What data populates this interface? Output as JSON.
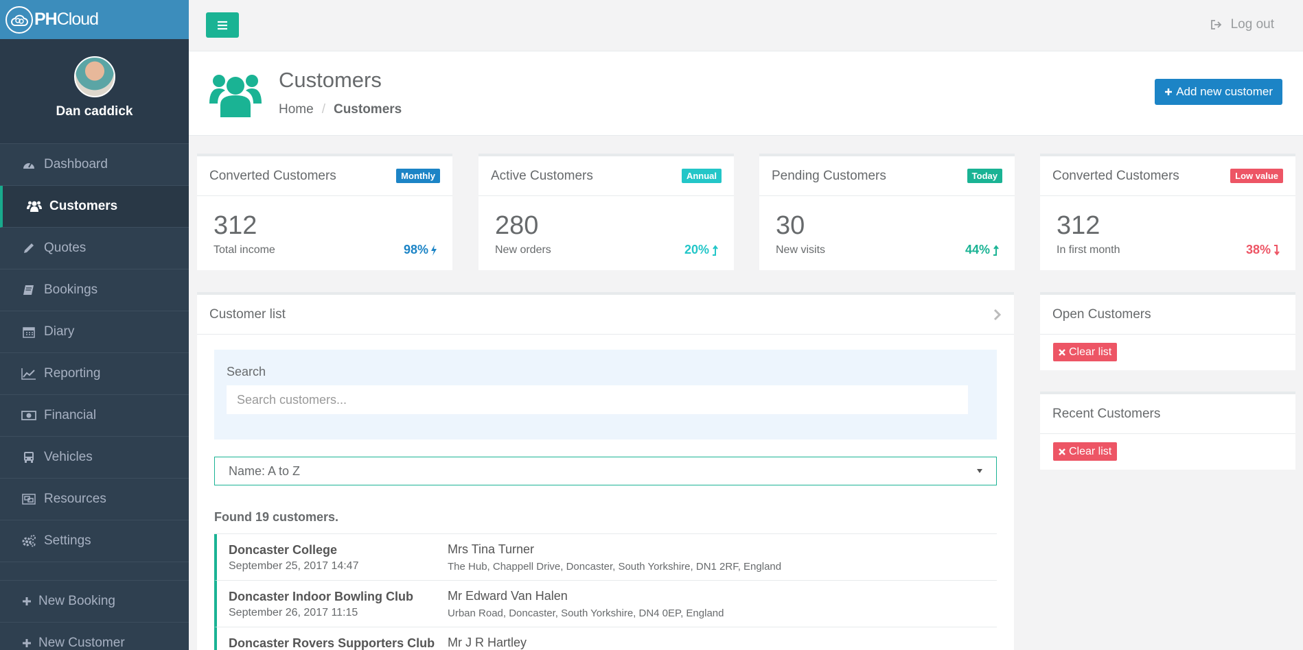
{
  "brand": {
    "name": "PHCloud",
    "name_bold": "PH",
    "name_rest": "Cloud"
  },
  "user": {
    "name": "Dan caddick"
  },
  "sidebar": {
    "items": [
      {
        "label": "Dashboard",
        "icon": "dashboard-icon"
      },
      {
        "label": "Customers",
        "icon": "users-icon",
        "active": true
      },
      {
        "label": "Quotes",
        "icon": "pencil-icon"
      },
      {
        "label": "Bookings",
        "icon": "book-icon"
      },
      {
        "label": "Diary",
        "icon": "calendar-icon"
      },
      {
        "label": "Reporting",
        "icon": "line-chart-icon"
      },
      {
        "label": "Financial",
        "icon": "money-icon"
      },
      {
        "label": "Vehicles",
        "icon": "bus-icon"
      },
      {
        "label": "Resources",
        "icon": "object-group-icon"
      },
      {
        "label": "Settings",
        "icon": "cogs-icon"
      }
    ],
    "actions": [
      {
        "label": "New Booking",
        "icon": "plus-icon"
      },
      {
        "label": "New Customer",
        "icon": "plus-icon"
      }
    ]
  },
  "topbar": {
    "logout_label": "Log out"
  },
  "heading": {
    "title": "Customers",
    "breadcrumb_home": "Home",
    "breadcrumb_sep": "/",
    "breadcrumb_current": "Customers",
    "add_button": "Add new customer"
  },
  "stats": [
    {
      "title": "Converted Customers",
      "badge": "Monthly",
      "badge_color": "#1c84c6",
      "value": "312",
      "sub": "Total income",
      "pct": "98%",
      "pct_color": "#1c84c6",
      "trend": "bolt"
    },
    {
      "title": "Active Customers",
      "badge": "Annual",
      "badge_color": "#23c6c8",
      "value": "280",
      "sub": "New orders",
      "pct": "20%",
      "pct_color": "#23c6c8",
      "trend": "up"
    },
    {
      "title": "Pending Customers",
      "badge": "Today",
      "badge_color": "#1ab394",
      "value": "30",
      "sub": "New visits",
      "pct": "44%",
      "pct_color": "#1ab394",
      "trend": "up"
    },
    {
      "title": "Converted Customers",
      "badge": "Low value",
      "badge_color": "#ed5565",
      "value": "312",
      "sub": "In first month",
      "pct": "38%",
      "pct_color": "#ed5565",
      "trend": "down"
    }
  ],
  "customer_list": {
    "title": "Customer list",
    "search_label": "Search",
    "search_placeholder": "Search customers...",
    "search_value": "",
    "sort_selected": "Name: A to Z",
    "found_text": "Found 19 customers.",
    "rows": [
      {
        "name": "Doncaster College",
        "date": "September 25, 2017 14:47",
        "contact": "Mrs Tina Turner",
        "address": "The Hub, Chappell Drive, Doncaster, South Yorkshire, DN1 2RF, England"
      },
      {
        "name": "Doncaster Indoor Bowling Club",
        "date": "September 26, 2017 11:15",
        "contact": "Mr Edward Van Halen",
        "address": "Urban Road, Doncaster, South Yorkshire, DN4 0EP, England"
      },
      {
        "name": "Doncaster Rovers Supporters Club",
        "date": "",
        "contact": "Mr J R Hartley",
        "address": ""
      }
    ]
  },
  "open_customers": {
    "title": "Open Customers",
    "clear_label": "Clear list"
  },
  "recent_customers": {
    "title": "Recent Customers",
    "clear_label": "Clear list"
  },
  "colors": {
    "accent": "#1ab394",
    "sidebar": "#2f4050",
    "brand": "#3c8dbc",
    "primary": "#1c84c6",
    "danger": "#ed5565"
  }
}
